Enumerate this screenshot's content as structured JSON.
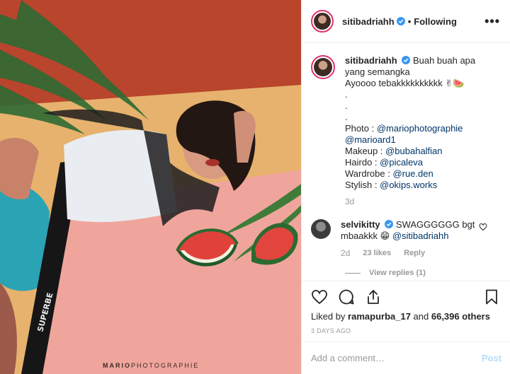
{
  "photo": {
    "watermark_bold": "MARIO",
    "watermark_rest": "PHOTOGRAPHIE",
    "belt_text": "SUPERBE"
  },
  "header": {
    "username": "sitibadriahh",
    "dot": "•",
    "follow_status": "Following",
    "more": "•••"
  },
  "caption": {
    "username": "sitibadriahh",
    "lines_before": [
      "Buah buah apa yang semangka",
      "Ayoooo tebakkkkkkkkkk ✌🍉",
      ".",
      ".",
      "."
    ],
    "credits": [
      {
        "label": "Photo : ",
        "mention": "@mariophotographie"
      },
      {
        "label": "",
        "mention": "@marioard1"
      },
      {
        "label": "Makeup : ",
        "mention": "@bubahalfian"
      },
      {
        "label": "Hairdo : ",
        "mention": "@picaleva"
      },
      {
        "label": "Wardrobe : ",
        "mention": "@rue.den"
      },
      {
        "label": "Stylish : ",
        "mention": "@okips.works"
      }
    ],
    "time": "3d"
  },
  "comment": {
    "username": "selvikitty",
    "text": "SWAGGGGGG bgt mbaakkk 😁",
    "mention": "@sitibadriahh",
    "time": "2d",
    "likes": "23 likes",
    "reply": "Reply",
    "view_replies": "View replies (1)"
  },
  "actions": {
    "liked_prefix": "Liked by ",
    "liked_user": "ramapurba_17",
    "liked_and": " and ",
    "liked_count": "66,396 others",
    "timestamp": "3 DAYS AGO"
  },
  "add_comment": {
    "placeholder": "Add a comment…",
    "post_label": "Post"
  },
  "colors": {
    "link": "#003569",
    "verified": "#3897f0",
    "post_disabled": "#b2dffc",
    "ring": "#e1306c"
  },
  "icons": [
    "verified-badge-icon",
    "heart-icon",
    "comment-icon",
    "share-icon",
    "bookmark-icon",
    "more-options-icon"
  ]
}
